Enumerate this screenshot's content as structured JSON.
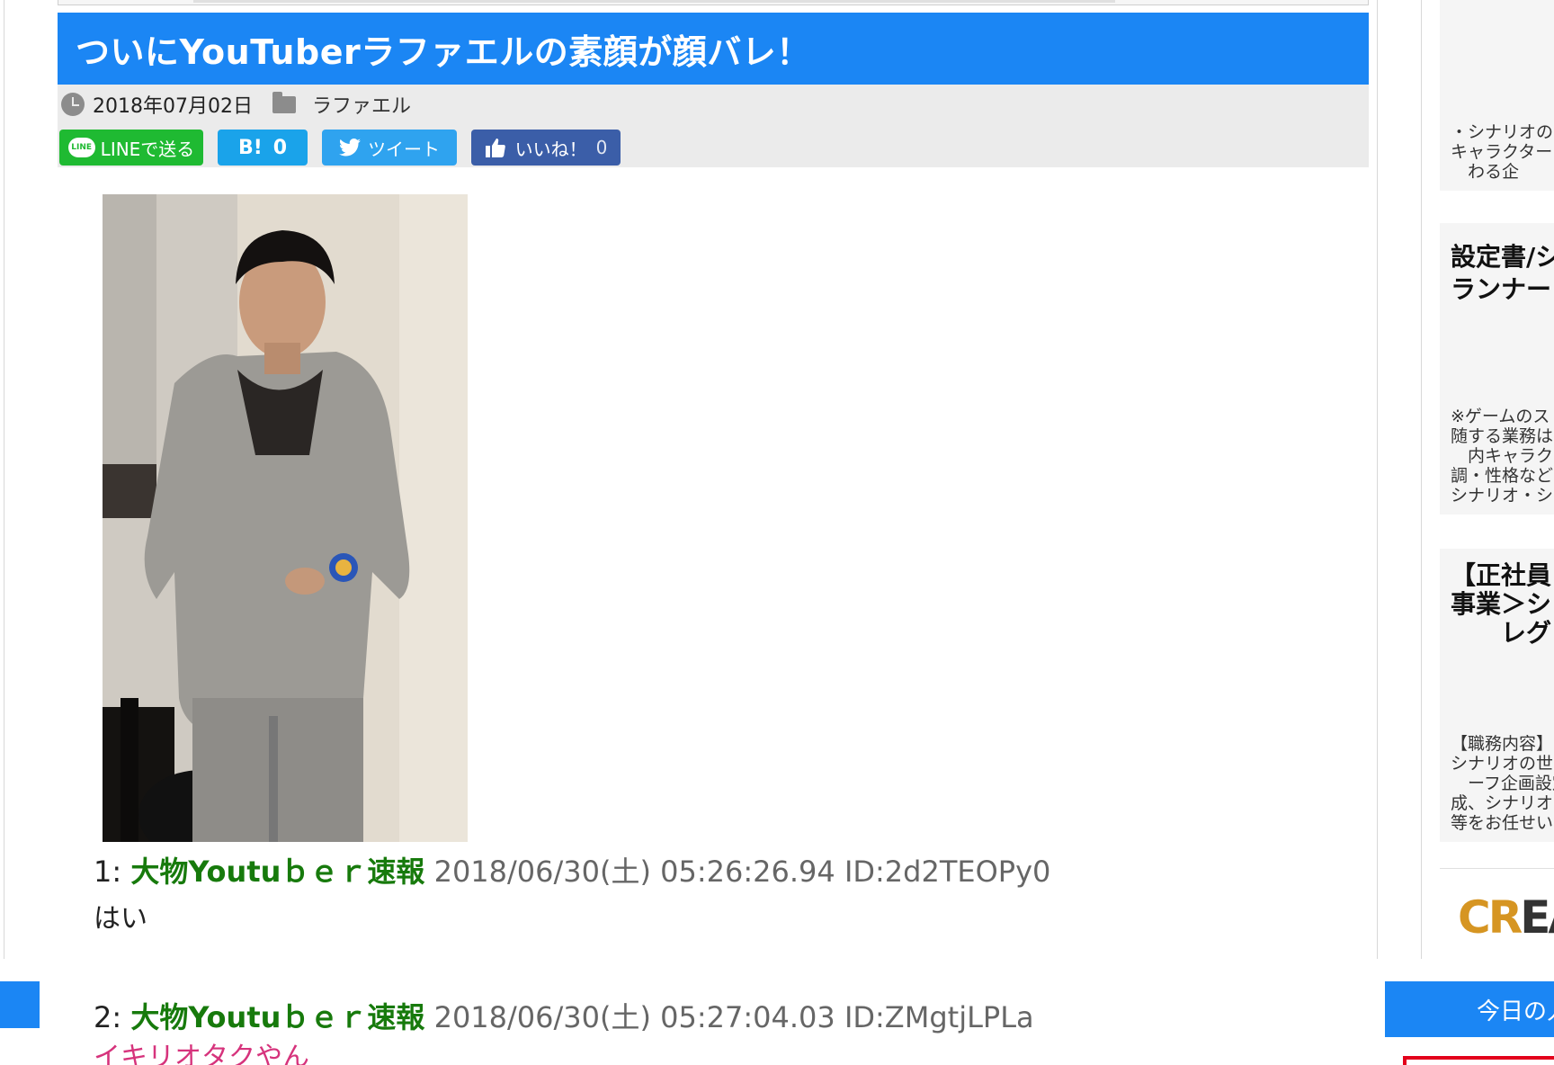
{
  "article": {
    "title": "ついにYouTuberラファエルの素顔が顔バレ！",
    "date": "2018年07月02日",
    "category": "ラファエル"
  },
  "share": {
    "line_icon": "LINE",
    "line_label": "LINEで送る",
    "hatena_label": "B!",
    "hatena_count": "0",
    "tweet_label": "ツイート",
    "like_label": "いいね！",
    "like_count": "0"
  },
  "comments": [
    {
      "num": "1:",
      "name": "大物Youtuｂｅｒ速報",
      "meta": "2018/06/30(土) 05:26:26.94 ID:2d2TEOPy0",
      "body": "はい"
    },
    {
      "num": "2:",
      "name": "大物Youtuｂｅｒ速報",
      "meta": "2018/06/30(土) 05:27:04.03 ID:ZMgtjLPLa",
      "body": "イキリオタクやん"
    }
  ],
  "sidebar": {
    "ad1": {
      "lines": [
        "・シナリオの",
        "キャラクター",
        "　わる企"
      ]
    },
    "ad2": {
      "title_lines": [
        "設定書/シ",
        "ランナー"
      ],
      "lines": [
        "※ゲームのス",
        "随する業務は",
        "　内キャラク",
        "調・性格など",
        "シナリオ・シ"
      ]
    },
    "ad3": {
      "title_lines": [
        "【正社員",
        "事業＞シ",
        "　　レグ"
      ],
      "lines": [
        "【職務内容】",
        "シナリオの世",
        "　ーフ企画設定",
        "成、シナリオ",
        "等をお任せい"
      ]
    },
    "logo_cr": "CR",
    "logo_rest": "EATIVE",
    "ranking_title": "今日の人気記事"
  },
  "colors": {
    "accent_blue": "#1b86f4",
    "name_green": "#177a0c",
    "reply_pink": "#d6337c",
    "line_green": "#1fba32",
    "hatena_blue": "#1aa3ea",
    "twitter_blue": "#2fa3ef",
    "facebook_blue": "#3b5ea8"
  }
}
